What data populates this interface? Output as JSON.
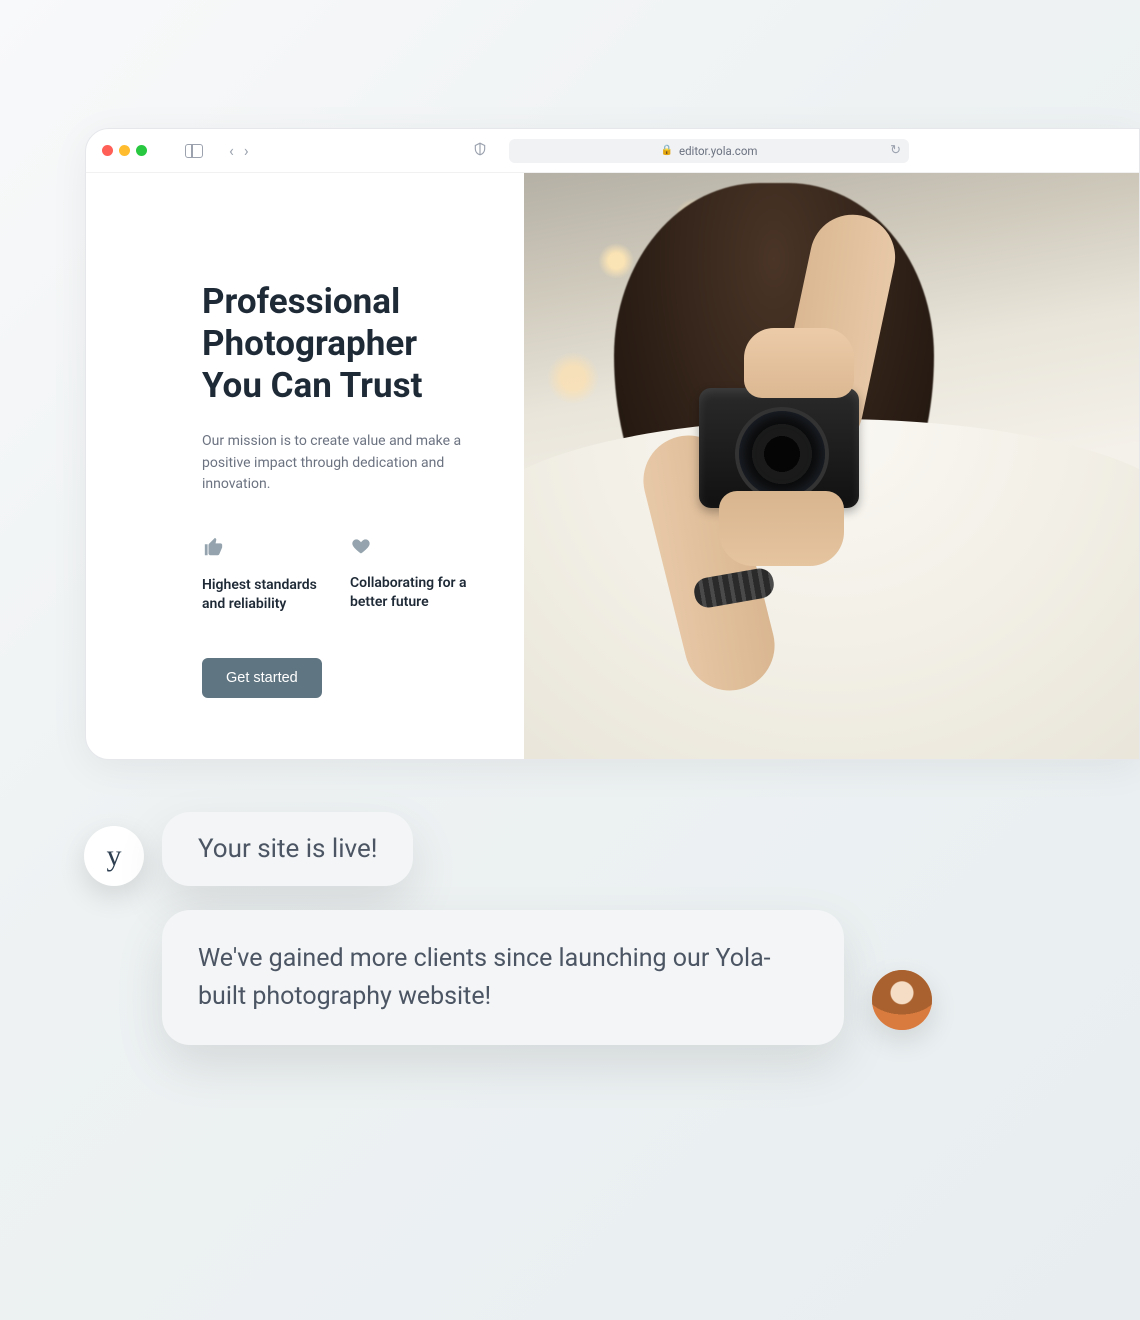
{
  "browser": {
    "url": "editor.yola.com"
  },
  "hero": {
    "heading_line1": "Professional",
    "heading_line2": "Photographer",
    "heading_line3": "You Can Trust",
    "mission": "Our mission is to create value and make a positive impact through dedication and innovation.",
    "features": [
      {
        "icon": "thumbs-up-icon",
        "text": "Highest standards and reliability"
      },
      {
        "icon": "heart-icon",
        "text": "Collaborating for a better future"
      }
    ],
    "cta": "Get started"
  },
  "chat": {
    "ai_avatar_letter": "y",
    "msg1": "Your site is live!",
    "msg2": "We've gained more clients since launching our Yola-built photography website!"
  }
}
